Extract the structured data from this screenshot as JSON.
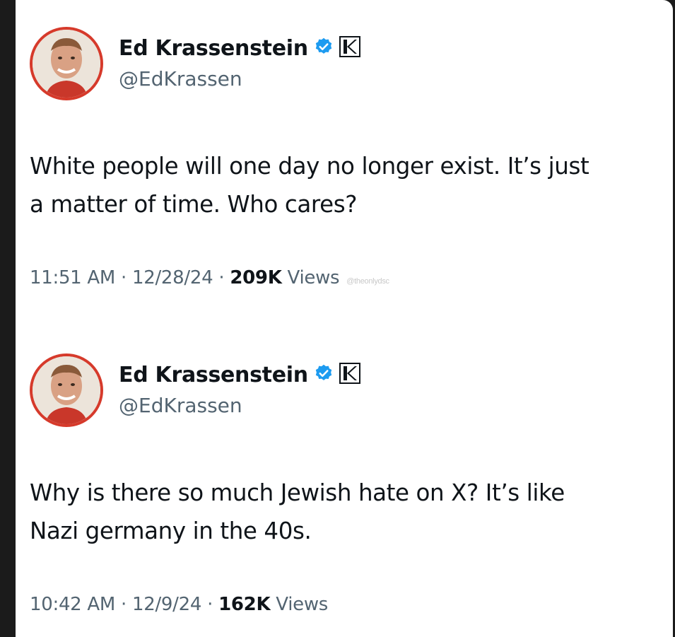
{
  "tweets": [
    {
      "display_name": "Ed Krassenstein",
      "handle": "@EdKrassen",
      "text_line1": "White people will one day no longer exist. It’s just",
      "text_line2": "a matter of time. Who cares?",
      "time": "11:51 AM",
      "date": "12/28/24",
      "views_count": "209K",
      "views_label": "Views",
      "watermark": "@theonlydsc",
      "icons": [
        "avatar",
        "verified-badge-icon",
        "affiliate-k-icon"
      ]
    },
    {
      "display_name": "Ed Krassenstein",
      "handle": "@EdKrassen",
      "text_line1": "Why is there so much Jewish hate on X?  It’s like",
      "text_line2": "Nazi germany in the 40s.",
      "time": "10:42 AM",
      "date": "12/9/24",
      "views_count": "162K",
      "views_label": "Views",
      "icons": [
        "avatar",
        "verified-badge-icon",
        "affiliate-k-icon"
      ]
    }
  ],
  "separator": "·",
  "colors": {
    "verified_blue": "#1d9bf0",
    "avatar_ring": "#d63a2b",
    "text_primary": "#0f1419",
    "text_secondary": "#536471"
  }
}
